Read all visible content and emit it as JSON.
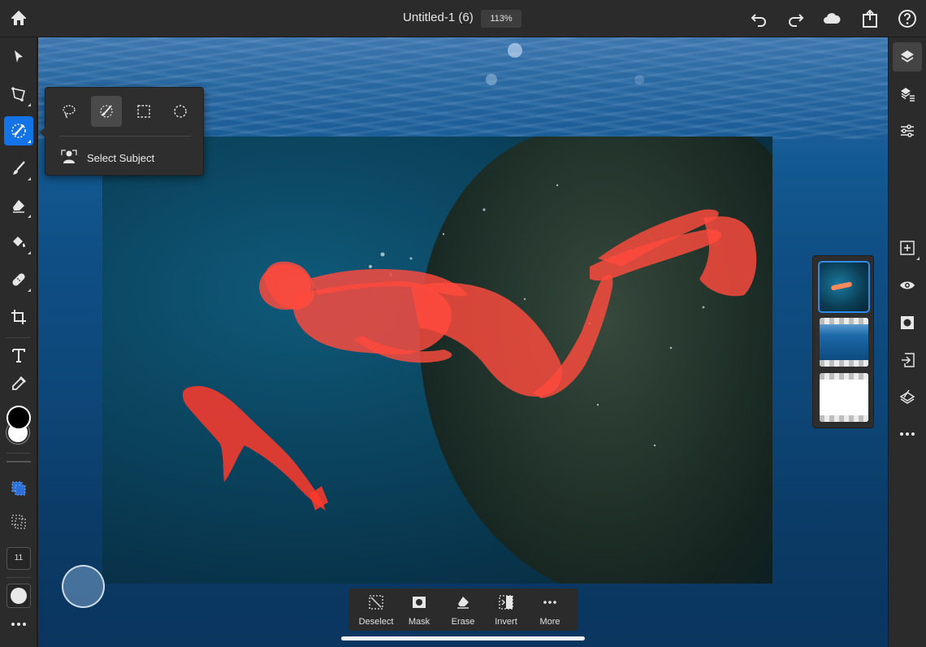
{
  "topbar": {
    "title": "Untitled-1 (6)",
    "zoom": "113%",
    "icons": [
      "home-icon",
      "undo-icon",
      "redo-icon",
      "cloud-icon",
      "share-icon",
      "help-icon"
    ]
  },
  "left_toolbar": {
    "tools": [
      "move-tool",
      "transform-tool",
      "selection-tool",
      "brush-tool",
      "eraser-tool",
      "fill-tool",
      "heal-tool",
      "crop-tool",
      "type-tool",
      "eyedropper-tool"
    ],
    "active_tool": "selection-tool",
    "colors": {
      "foreground": "#000000",
      "background": "#ffffff"
    },
    "brush_size": "11"
  },
  "selection_popover": {
    "modes": [
      "lasso-select",
      "brush-select",
      "rectangle-select",
      "ellipse-select"
    ],
    "active_mode": "brush-select",
    "select_subject_label": "Select Subject"
  },
  "right_toolbar": {
    "tools": [
      "layers-icon",
      "layer-properties-icon",
      "adjustments-icon",
      "add-layer-icon",
      "visibility-icon",
      "mask-icon",
      "import-icon",
      "clipping-icon",
      "more-icon"
    ],
    "active_tool": "layers-icon"
  },
  "bottom_bar": {
    "actions": [
      {
        "label": "Deselect",
        "icon": "deselect-icon"
      },
      {
        "label": "Mask",
        "icon": "mask-icon"
      },
      {
        "label": "Erase",
        "icon": "erase-icon"
      },
      {
        "label": "Invert",
        "icon": "invert-icon"
      },
      {
        "label": "More",
        "icon": "more-icon"
      }
    ]
  },
  "colors": {
    "accent": "#1473e6",
    "selection_overlay": "#ff4a3d"
  }
}
